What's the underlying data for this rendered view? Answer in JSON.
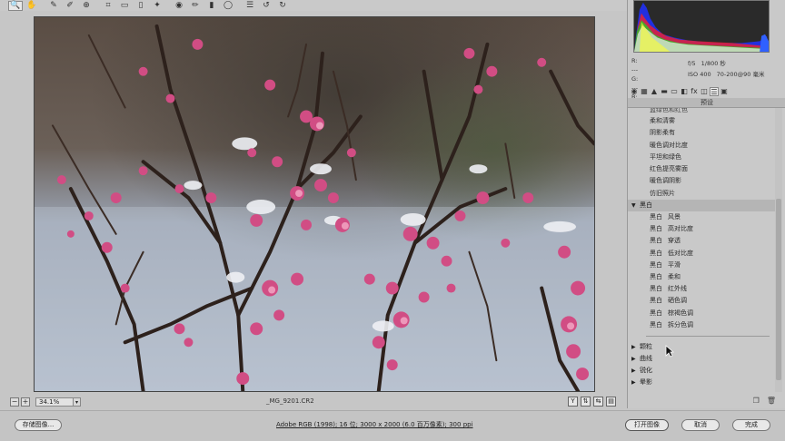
{
  "toolbar": {
    "tools": [
      "zoom-tool",
      "hand-tool",
      "white-balance-tool",
      "color-sampler-tool",
      "targeted-adjustment-tool",
      "crop-tool",
      "straighten-tool",
      "transform-tool",
      "spot-removal-tool",
      "red-eye-tool",
      "adjustment-brush-tool",
      "graduated-filter-tool",
      "radial-filter-tool",
      "preferences-tool",
      "rotate-left-tool",
      "rotate-right-tool"
    ],
    "tool_glyphs": [
      "🔍",
      "✋",
      "✎",
      "✐",
      "⊕",
      "⌗",
      "▭",
      "▯",
      "✦",
      "◉",
      "✏",
      "▮",
      "◯",
      "☰",
      "↺",
      "↻"
    ]
  },
  "status": {
    "zoom_value": "34.1%",
    "filename": "_MG_9201.CR2",
    "zoom_out": "−",
    "zoom_in": "+"
  },
  "exif": {
    "r_label": "R:",
    "g_label": "G:",
    "b_label": "B:",
    "r_value": "---",
    "g_value": "---",
    "b_value": "---",
    "aperture": "f/5",
    "shutter": "1/800 秒",
    "iso": "ISO 400",
    "lens": "70-200@90 毫米"
  },
  "panel": {
    "title": "预设",
    "clipped_item": "蓝绿色和红色",
    "presets_top": [
      "柔和清雾",
      "阴影柔有",
      "暖色调对比度",
      "平坦和绿色",
      "红色提亮雾面",
      "暖色调阴影",
      "仿旧照片"
    ],
    "bw_group": "黑白",
    "bw_items": [
      [
        "黑白",
        "风景"
      ],
      [
        "黑白",
        "高对比度"
      ],
      [
        "黑白",
        "穿透"
      ],
      [
        "黑白",
        "低对比度"
      ],
      [
        "黑白",
        "平滑"
      ],
      [
        "黑白",
        "柔和"
      ],
      [
        "黑白",
        "红外线"
      ],
      [
        "黑白",
        "硒色调"
      ],
      [
        "黑白",
        "棕褐色调"
      ],
      [
        "黑白",
        "拆分色调"
      ]
    ],
    "collapsed_groups": [
      "颗粒",
      "曲线",
      "锐化",
      "晕影"
    ]
  },
  "actions": {
    "save_image": "存储图像...",
    "workflow": "Adobe RGB (1998); 16 位; 3000 x 2000 (6.0 百万像素); 300 ppi",
    "open_image": "打开图像",
    "cancel": "取消",
    "done": "完成"
  }
}
